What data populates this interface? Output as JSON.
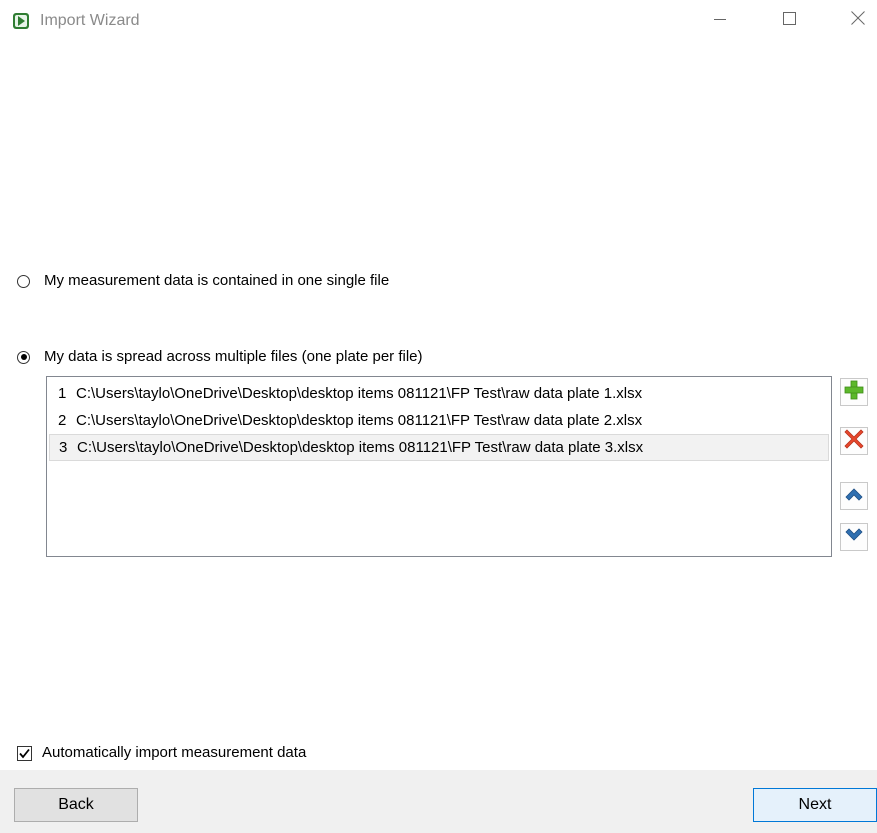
{
  "window": {
    "title": "Import Wizard",
    "controls": {
      "minimize_icon": "minimize-icon",
      "maximize_icon": "maximize-icon",
      "close_icon": "close-icon"
    }
  },
  "options": {
    "single_file": {
      "label": "My measurement data is contained in one single file",
      "selected": false
    },
    "multiple_files": {
      "label": "My data is spread across multiple files (one plate per file)",
      "selected": true
    }
  },
  "files": [
    {
      "index": "1",
      "path": "C:\\Users\\taylo\\OneDrive\\Desktop\\desktop items 081121\\FP Test\\raw data plate 1.xlsx",
      "selected": false
    },
    {
      "index": "2",
      "path": "C:\\Users\\taylo\\OneDrive\\Desktop\\desktop items 081121\\FP Test\\raw data plate 2.xlsx",
      "selected": false
    },
    {
      "index": "3",
      "path": "C:\\Users\\taylo\\OneDrive\\Desktop\\desktop items 081121\\FP Test\\raw data plate 3.xlsx",
      "selected": true
    }
  ],
  "file_actions": {
    "add_icon": "plus-icon",
    "remove_icon": "x-icon",
    "up_icon": "chevron-up-icon",
    "down_icon": "chevron-down-icon"
  },
  "auto_import": {
    "label": "Automatically import measurement data",
    "checked": true
  },
  "footer": {
    "back_label": "Back",
    "next_label": "Next"
  },
  "colors": {
    "add_green": "#5cb82b",
    "remove_red": "#e8472c",
    "arrow_blue": "#2f6fb0",
    "next_border": "#0078d7"
  }
}
